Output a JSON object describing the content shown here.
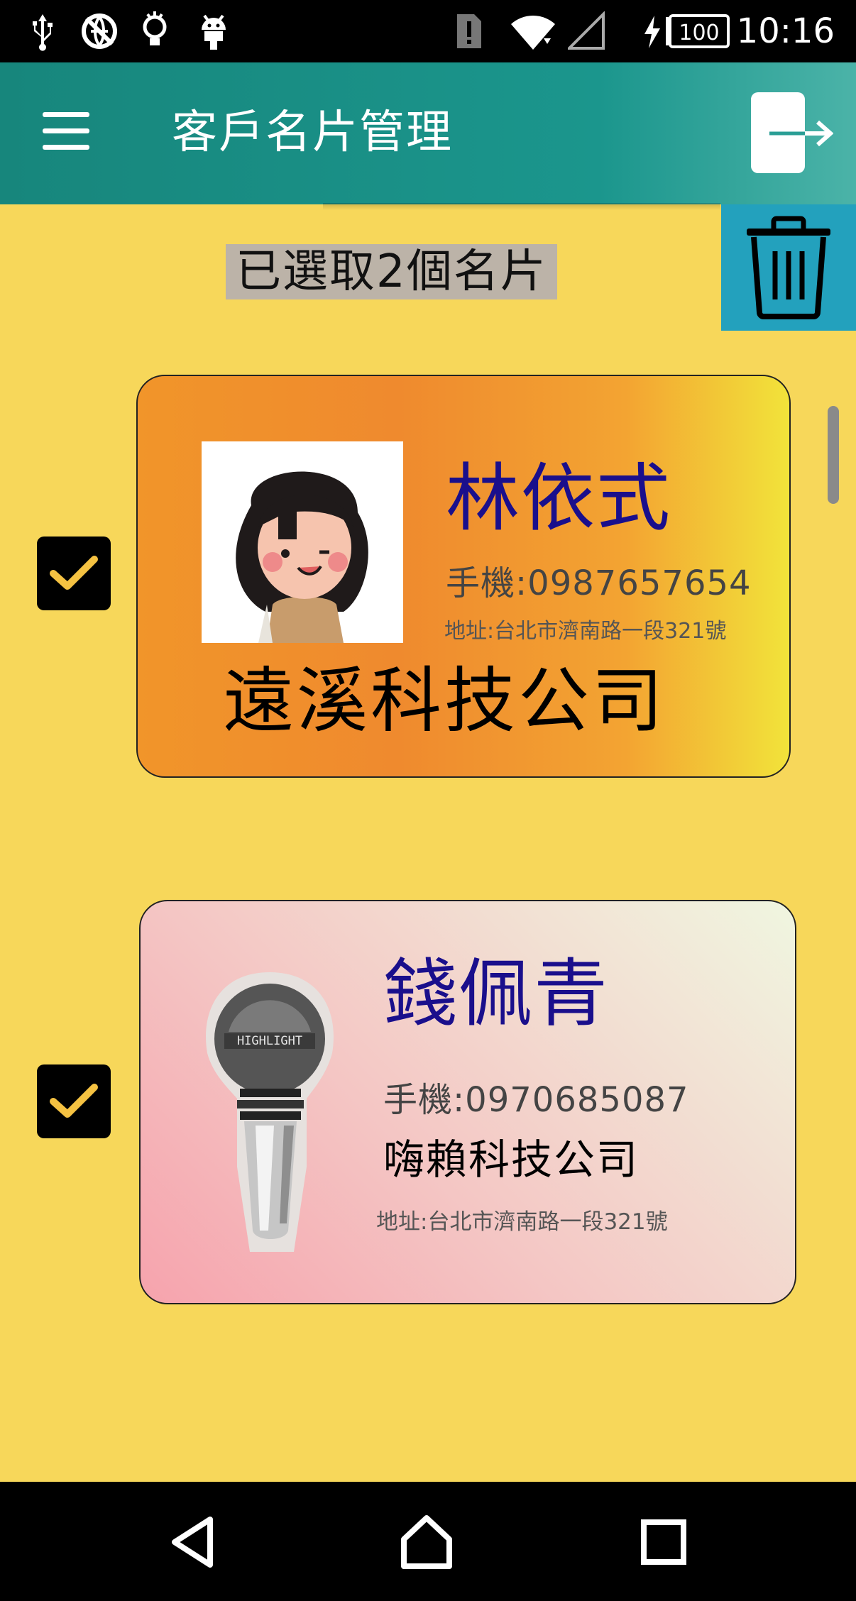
{
  "status_bar": {
    "time": "10:16",
    "battery": "100",
    "icons": [
      "usb-icon",
      "vpn-off-icon",
      "lightbulb-icon",
      "android-icon",
      "sim-alert-icon",
      "wifi-icon",
      "signal-icon",
      "battery-charging-icon"
    ]
  },
  "app_bar": {
    "title": "客戶名片管理",
    "menu_icon": "hamburger-menu-icon",
    "logout_icon": "logout-icon",
    "color": "#17867c"
  },
  "selection": {
    "text": "已選取2個名片",
    "delete_icon": "trash-icon",
    "delete_color": "#23a1bd"
  },
  "cards": [
    {
      "checked": true,
      "name": "林依式",
      "phone": "手機:0987657654",
      "address": "地址:台北市濟南路一段321號",
      "company": "遠溪科技公司",
      "image": "cartoon-girl-avatar"
    },
    {
      "checked": true,
      "name": "錢佩青",
      "phone": "手機:0970685087",
      "company": "嗨賴科技公司",
      "address": "地址:台北市濟南路一段321號",
      "image": "lightbulb-lightstick",
      "image_text": "HIGHLIGHT"
    }
  ],
  "nav_bar": {
    "buttons": [
      "back-icon",
      "home-icon",
      "recents-icon"
    ]
  },
  "colors": {
    "background": "#f7d75a",
    "checkbox_check": "#f5c242",
    "name_color": "#1a0f8c"
  }
}
